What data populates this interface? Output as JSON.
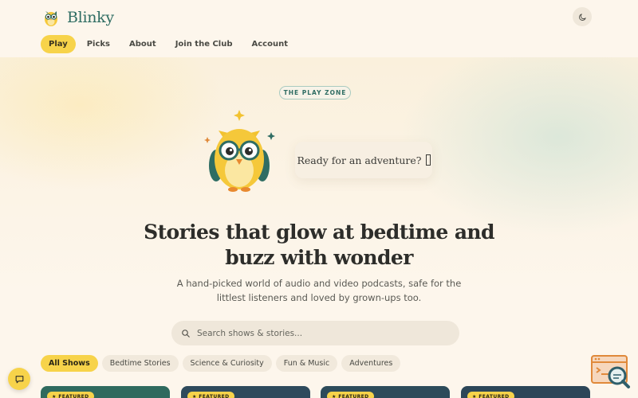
{
  "brand": {
    "name": "Blinky"
  },
  "nav": [
    {
      "label": "Play",
      "active": true
    },
    {
      "label": "Picks",
      "active": false
    },
    {
      "label": "About",
      "active": false
    },
    {
      "label": "Join the Club",
      "active": false
    },
    {
      "label": "Account",
      "active": false
    }
  ],
  "theme_toggle": {
    "icon": "moon-icon"
  },
  "hero": {
    "eyebrow": "THE PLAY ZONE",
    "bubble_text": "Ready for an adventure?",
    "headline": "Stories that glow at bedtime and buzz with wonder",
    "subtext": "A hand-picked world of audio and video podcasts, safe for the littlest listeners and loved by grown-ups too."
  },
  "search": {
    "placeholder": "Search shows & stories..."
  },
  "filters": [
    {
      "label": "All Shows",
      "active": true
    },
    {
      "label": "Bedtime Stories",
      "active": false
    },
    {
      "label": "Science & Curiosity",
      "active": false
    },
    {
      "label": "Fun & Music",
      "active": false
    },
    {
      "label": "Adventures",
      "active": false
    }
  ],
  "cards": [
    {
      "badge": "★ FEATURED",
      "color": "#2f6a5e"
    },
    {
      "badge": "★ FEATURED",
      "color": "#2e4a5c"
    },
    {
      "badge": "★ FEATURED",
      "color": "#2d4b5a"
    },
    {
      "badge": "★ FEATURED",
      "color": "#2c4658"
    }
  ],
  "colors": {
    "accent": "#f7d34a",
    "brand": "#2f6d63",
    "background": "#fdf6ec"
  }
}
